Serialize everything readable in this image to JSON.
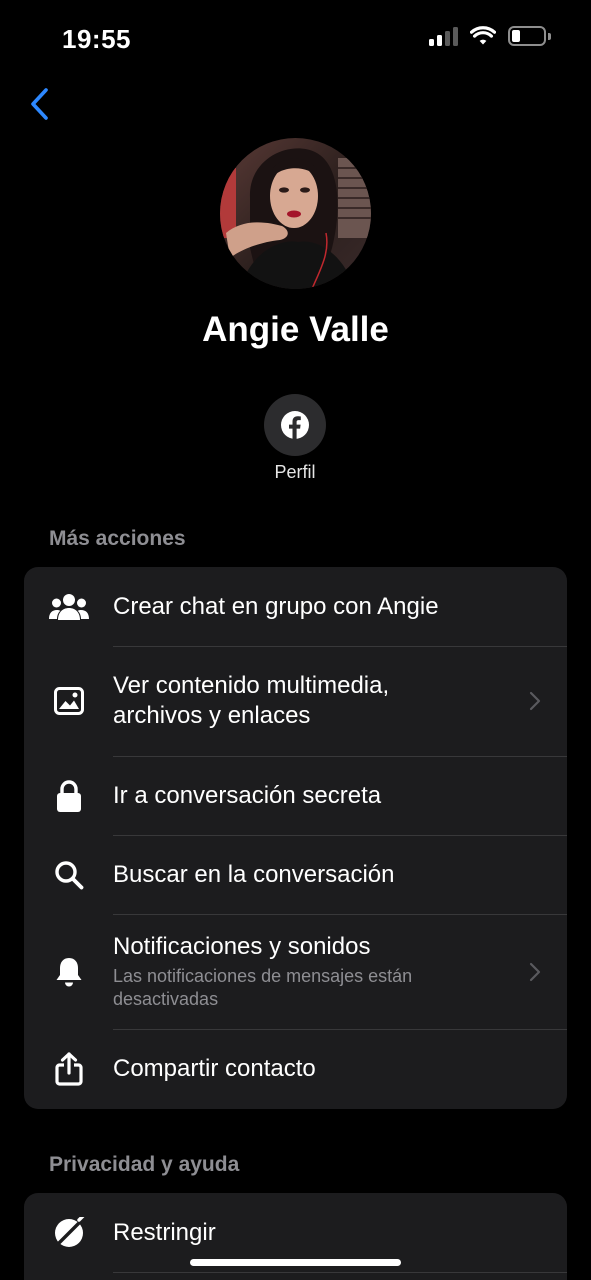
{
  "status_bar": {
    "time": "19:55",
    "battery_level": 0.25
  },
  "nav": {
    "back_icon": "chevron-left-icon",
    "accent": "#2d88ff"
  },
  "profile": {
    "name": "Angie Valle",
    "facebook_label": "Perfil"
  },
  "more_actions": {
    "title": "Más acciones",
    "items": [
      {
        "icon": "group-icon",
        "label": "Crear chat en grupo con Angie",
        "sub": ""
      },
      {
        "icon": "image-icon",
        "label": "Ver contenido multimedia, archivos y enlaces",
        "sub": ""
      },
      {
        "icon": "lock-icon",
        "label": "Ir a conversación secreta",
        "sub": ""
      },
      {
        "icon": "search-icon",
        "label": "Buscar en la conversación",
        "sub": ""
      },
      {
        "icon": "bell-icon",
        "label": "Notificaciones y sonidos",
        "sub": "Las notificaciones de mensajes están desactivadas"
      },
      {
        "icon": "share-icon",
        "label": "Compartir contacto",
        "sub": ""
      }
    ]
  },
  "privacy": {
    "title": "Privacidad y ayuda",
    "items": [
      {
        "icon": "restrict-icon",
        "label": "Restringir"
      }
    ]
  },
  "colors": {
    "background": "#000000",
    "card": "#1c1c1e",
    "separator": "#38383a",
    "secondary_text": "#8e8e93"
  }
}
